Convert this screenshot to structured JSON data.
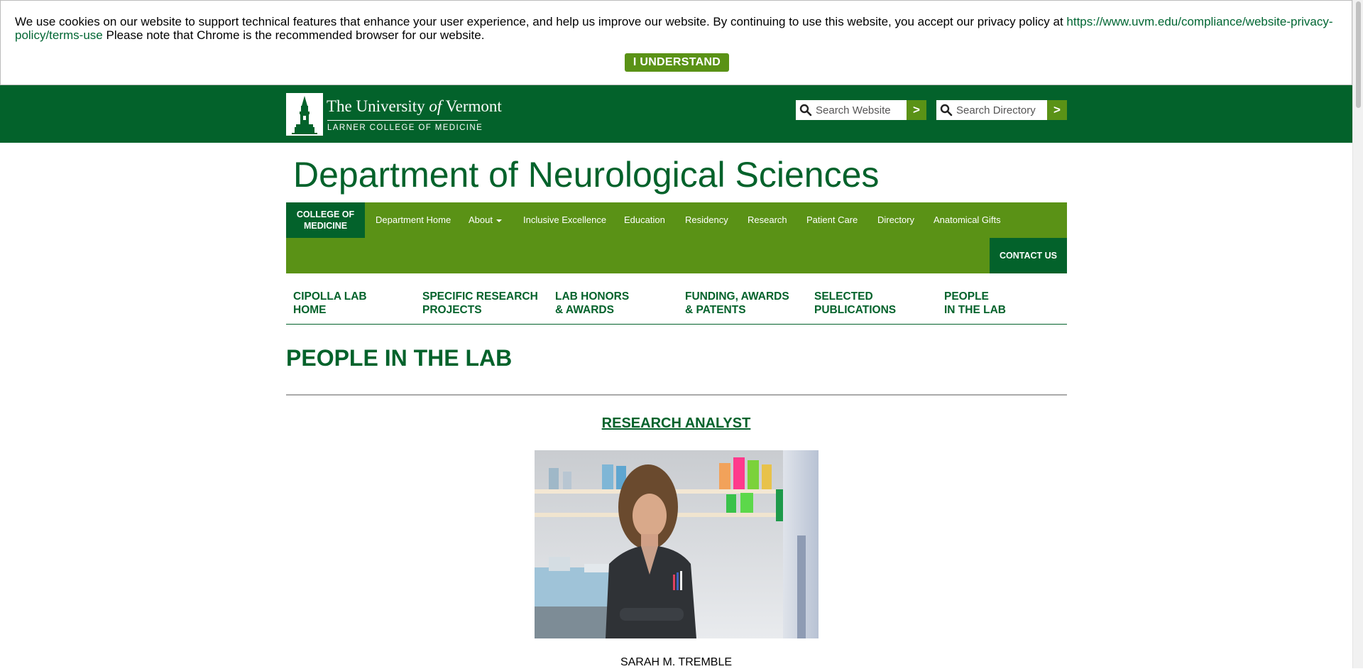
{
  "cookie_banner": {
    "text": "We use cookies on our website to support technical features that enhance your user experience, and help us improve our website. By continuing to use this website, you accept our privacy policy at ",
    "link": "https://www.uvm.edu/compliance/website-privacy-policy/terms-use",
    "text_after": " Please note that Chrome is the recommended browser for our website.",
    "button": "I UNDERSTAND"
  },
  "header": {
    "logo_name_1": "The University ",
    "logo_name_2": "of",
    "logo_name_3": " Vermont",
    "logo_sub": "LARNER COLLEGE OF MEDICINE",
    "search_website_placeholder": "Search Website",
    "search_directory_placeholder": "Search Directory",
    "go_label": ">"
  },
  "department_title": "Department of Neurological Sciences",
  "nav": {
    "college": "COLLEGE OF MEDICINE",
    "items": [
      "Department Home",
      "About",
      "Inclusive Excellence",
      "Education",
      "Residency",
      "Research",
      "Patient Care",
      "Directory",
      "Anatomical Gifts"
    ],
    "contact": "CONTACT US"
  },
  "subnav": [
    {
      "line1": "CIPOLLA LAB",
      "line2": "HOME"
    },
    {
      "line1": "SPECIFIC RESEARCH",
      "line2": "PROJECTS"
    },
    {
      "line1": "LAB HONORS",
      "line2": "& AWARDS"
    },
    {
      "line1": "FUNDING, AWARDS",
      "line2": "& PATENTS"
    },
    {
      "line1": "SELECTED",
      "line2": "PUBLICATIONS"
    },
    {
      "line1": "PEOPLE",
      "line2": "IN THE LAB"
    }
  ],
  "page_title": "PEOPLE IN THE LAB",
  "section_role": "RESEARCH ANALYST",
  "person_name": "SARAH M. TREMBLE",
  "colors": {
    "dark_green": "#03622b",
    "accent_green": "#5a9216"
  }
}
